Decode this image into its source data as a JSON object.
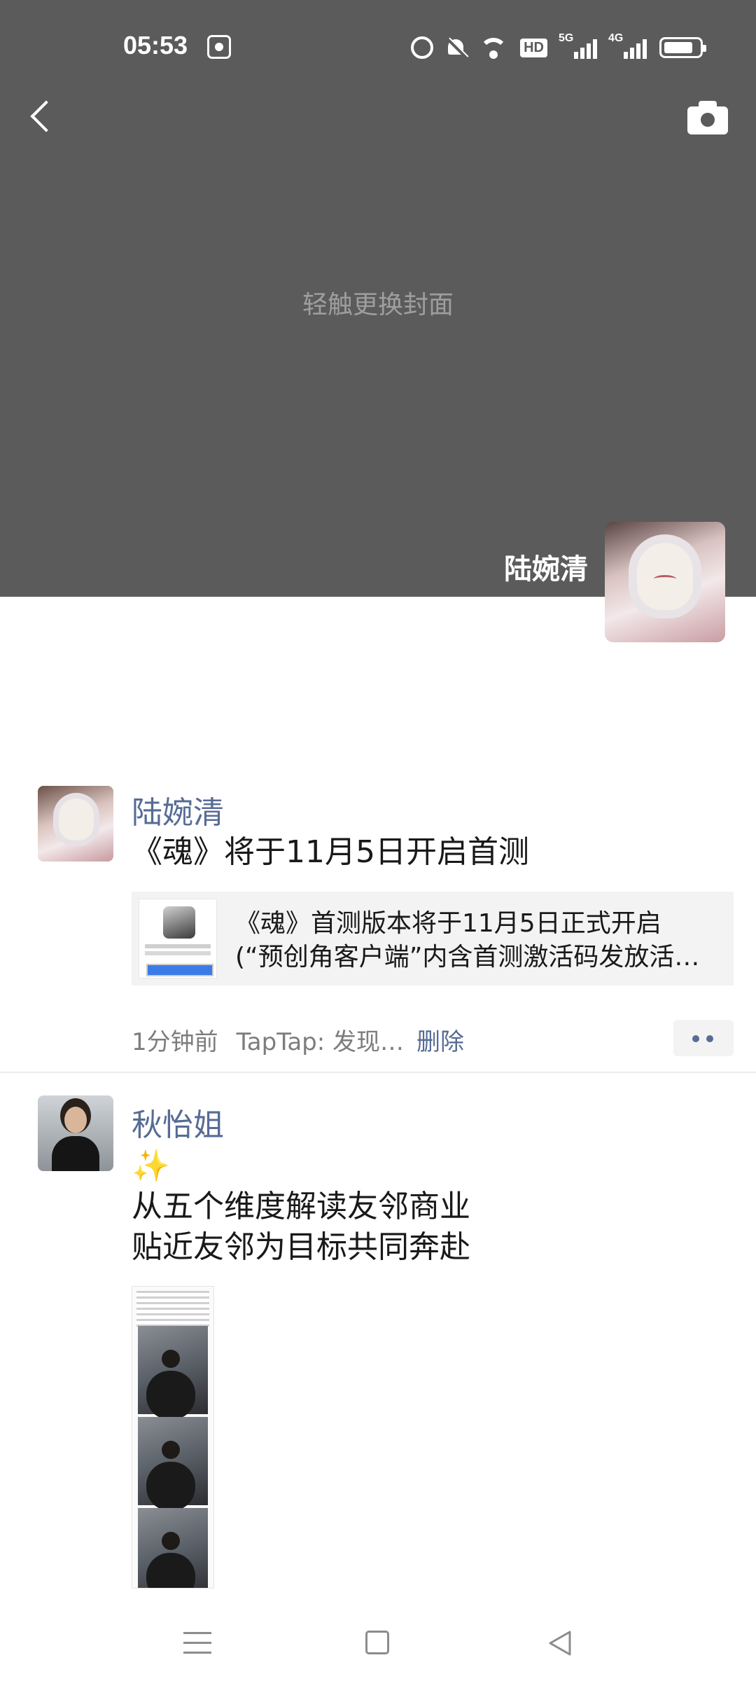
{
  "status_bar": {
    "time": "05:53",
    "icons": [
      "baidu-app-icon",
      "alarm-icon",
      "mute-icon",
      "wifi-icon",
      "hd-icon",
      "signal-5g-icon",
      "signal-4g-icon",
      "battery-icon"
    ],
    "hd_label": "HD",
    "signal_5g_label": "5G",
    "signal_4g_label": "4G"
  },
  "header": {
    "back_icon": "chevron-left-icon",
    "camera_icon": "camera-icon"
  },
  "cover": {
    "hint": "轻触更换封面",
    "owner_name": "陆婉清",
    "background_color": "#5b5b5b"
  },
  "posts": [
    {
      "nickname": "陆婉清",
      "text": "《魂》将于11月5日开启首测",
      "link": {
        "line1": "《魂》首测版本将于11月5日正式开启",
        "line2": "(“预创角客户端”内含首测激活码发放活…"
      },
      "time": "1分钟前",
      "source": "TapTap: 发现…",
      "delete_label": "删除"
    },
    {
      "nickname": "秋怡姐",
      "emoji": "✨",
      "text_line1": "从五个维度解读友邻商业",
      "text_line2": "贴近友邻为目标共同奔赴"
    }
  ],
  "colors": {
    "nickname": "#576b95",
    "text": "#191919",
    "meta": "#7d7d7d"
  }
}
